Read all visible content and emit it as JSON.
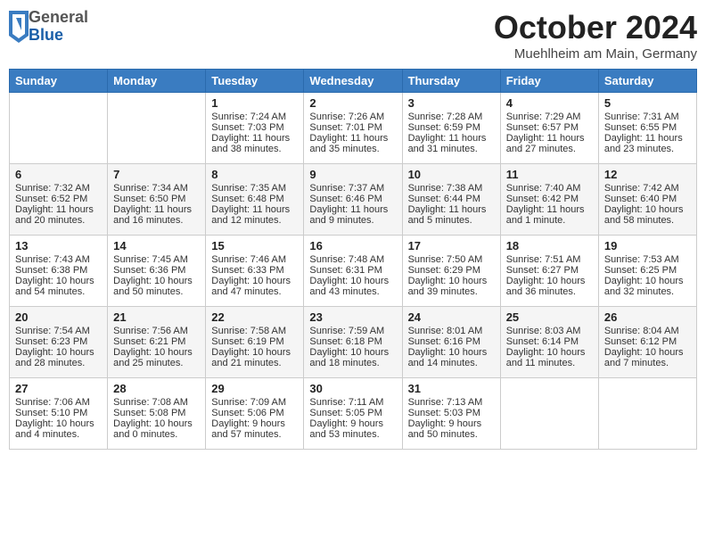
{
  "header": {
    "logo_general": "General",
    "logo_blue": "Blue",
    "month_title": "October 2024",
    "location": "Muehlheim am Main, Germany"
  },
  "days_of_week": [
    "Sunday",
    "Monday",
    "Tuesday",
    "Wednesday",
    "Thursday",
    "Friday",
    "Saturday"
  ],
  "weeks": [
    [
      {
        "day": "",
        "sunrise": "",
        "sunset": "",
        "daylight": ""
      },
      {
        "day": "",
        "sunrise": "",
        "sunset": "",
        "daylight": ""
      },
      {
        "day": "1",
        "sunrise": "Sunrise: 7:24 AM",
        "sunset": "Sunset: 7:03 PM",
        "daylight": "Daylight: 11 hours and 38 minutes."
      },
      {
        "day": "2",
        "sunrise": "Sunrise: 7:26 AM",
        "sunset": "Sunset: 7:01 PM",
        "daylight": "Daylight: 11 hours and 35 minutes."
      },
      {
        "day": "3",
        "sunrise": "Sunrise: 7:28 AM",
        "sunset": "Sunset: 6:59 PM",
        "daylight": "Daylight: 11 hours and 31 minutes."
      },
      {
        "day": "4",
        "sunrise": "Sunrise: 7:29 AM",
        "sunset": "Sunset: 6:57 PM",
        "daylight": "Daylight: 11 hours and 27 minutes."
      },
      {
        "day": "5",
        "sunrise": "Sunrise: 7:31 AM",
        "sunset": "Sunset: 6:55 PM",
        "daylight": "Daylight: 11 hours and 23 minutes."
      }
    ],
    [
      {
        "day": "6",
        "sunrise": "Sunrise: 7:32 AM",
        "sunset": "Sunset: 6:52 PM",
        "daylight": "Daylight: 11 hours and 20 minutes."
      },
      {
        "day": "7",
        "sunrise": "Sunrise: 7:34 AM",
        "sunset": "Sunset: 6:50 PM",
        "daylight": "Daylight: 11 hours and 16 minutes."
      },
      {
        "day": "8",
        "sunrise": "Sunrise: 7:35 AM",
        "sunset": "Sunset: 6:48 PM",
        "daylight": "Daylight: 11 hours and 12 minutes."
      },
      {
        "day": "9",
        "sunrise": "Sunrise: 7:37 AM",
        "sunset": "Sunset: 6:46 PM",
        "daylight": "Daylight: 11 hours and 9 minutes."
      },
      {
        "day": "10",
        "sunrise": "Sunrise: 7:38 AM",
        "sunset": "Sunset: 6:44 PM",
        "daylight": "Daylight: 11 hours and 5 minutes."
      },
      {
        "day": "11",
        "sunrise": "Sunrise: 7:40 AM",
        "sunset": "Sunset: 6:42 PM",
        "daylight": "Daylight: 11 hours and 1 minute."
      },
      {
        "day": "12",
        "sunrise": "Sunrise: 7:42 AM",
        "sunset": "Sunset: 6:40 PM",
        "daylight": "Daylight: 10 hours and 58 minutes."
      }
    ],
    [
      {
        "day": "13",
        "sunrise": "Sunrise: 7:43 AM",
        "sunset": "Sunset: 6:38 PM",
        "daylight": "Daylight: 10 hours and 54 minutes."
      },
      {
        "day": "14",
        "sunrise": "Sunrise: 7:45 AM",
        "sunset": "Sunset: 6:36 PM",
        "daylight": "Daylight: 10 hours and 50 minutes."
      },
      {
        "day": "15",
        "sunrise": "Sunrise: 7:46 AM",
        "sunset": "Sunset: 6:33 PM",
        "daylight": "Daylight: 10 hours and 47 minutes."
      },
      {
        "day": "16",
        "sunrise": "Sunrise: 7:48 AM",
        "sunset": "Sunset: 6:31 PM",
        "daylight": "Daylight: 10 hours and 43 minutes."
      },
      {
        "day": "17",
        "sunrise": "Sunrise: 7:50 AM",
        "sunset": "Sunset: 6:29 PM",
        "daylight": "Daylight: 10 hours and 39 minutes."
      },
      {
        "day": "18",
        "sunrise": "Sunrise: 7:51 AM",
        "sunset": "Sunset: 6:27 PM",
        "daylight": "Daylight: 10 hours and 36 minutes."
      },
      {
        "day": "19",
        "sunrise": "Sunrise: 7:53 AM",
        "sunset": "Sunset: 6:25 PM",
        "daylight": "Daylight: 10 hours and 32 minutes."
      }
    ],
    [
      {
        "day": "20",
        "sunrise": "Sunrise: 7:54 AM",
        "sunset": "Sunset: 6:23 PM",
        "daylight": "Daylight: 10 hours and 28 minutes."
      },
      {
        "day": "21",
        "sunrise": "Sunrise: 7:56 AM",
        "sunset": "Sunset: 6:21 PM",
        "daylight": "Daylight: 10 hours and 25 minutes."
      },
      {
        "day": "22",
        "sunrise": "Sunrise: 7:58 AM",
        "sunset": "Sunset: 6:19 PM",
        "daylight": "Daylight: 10 hours and 21 minutes."
      },
      {
        "day": "23",
        "sunrise": "Sunrise: 7:59 AM",
        "sunset": "Sunset: 6:18 PM",
        "daylight": "Daylight: 10 hours and 18 minutes."
      },
      {
        "day": "24",
        "sunrise": "Sunrise: 8:01 AM",
        "sunset": "Sunset: 6:16 PM",
        "daylight": "Daylight: 10 hours and 14 minutes."
      },
      {
        "day": "25",
        "sunrise": "Sunrise: 8:03 AM",
        "sunset": "Sunset: 6:14 PM",
        "daylight": "Daylight: 10 hours and 11 minutes."
      },
      {
        "day": "26",
        "sunrise": "Sunrise: 8:04 AM",
        "sunset": "Sunset: 6:12 PM",
        "daylight": "Daylight: 10 hours and 7 minutes."
      }
    ],
    [
      {
        "day": "27",
        "sunrise": "Sunrise: 7:06 AM",
        "sunset": "Sunset: 5:10 PM",
        "daylight": "Daylight: 10 hours and 4 minutes."
      },
      {
        "day": "28",
        "sunrise": "Sunrise: 7:08 AM",
        "sunset": "Sunset: 5:08 PM",
        "daylight": "Daylight: 10 hours and 0 minutes."
      },
      {
        "day": "29",
        "sunrise": "Sunrise: 7:09 AM",
        "sunset": "Sunset: 5:06 PM",
        "daylight": "Daylight: 9 hours and 57 minutes."
      },
      {
        "day": "30",
        "sunrise": "Sunrise: 7:11 AM",
        "sunset": "Sunset: 5:05 PM",
        "daylight": "Daylight: 9 hours and 53 minutes."
      },
      {
        "day": "31",
        "sunrise": "Sunrise: 7:13 AM",
        "sunset": "Sunset: 5:03 PM",
        "daylight": "Daylight: 9 hours and 50 minutes."
      },
      {
        "day": "",
        "sunrise": "",
        "sunset": "",
        "daylight": ""
      },
      {
        "day": "",
        "sunrise": "",
        "sunset": "",
        "daylight": ""
      }
    ]
  ]
}
